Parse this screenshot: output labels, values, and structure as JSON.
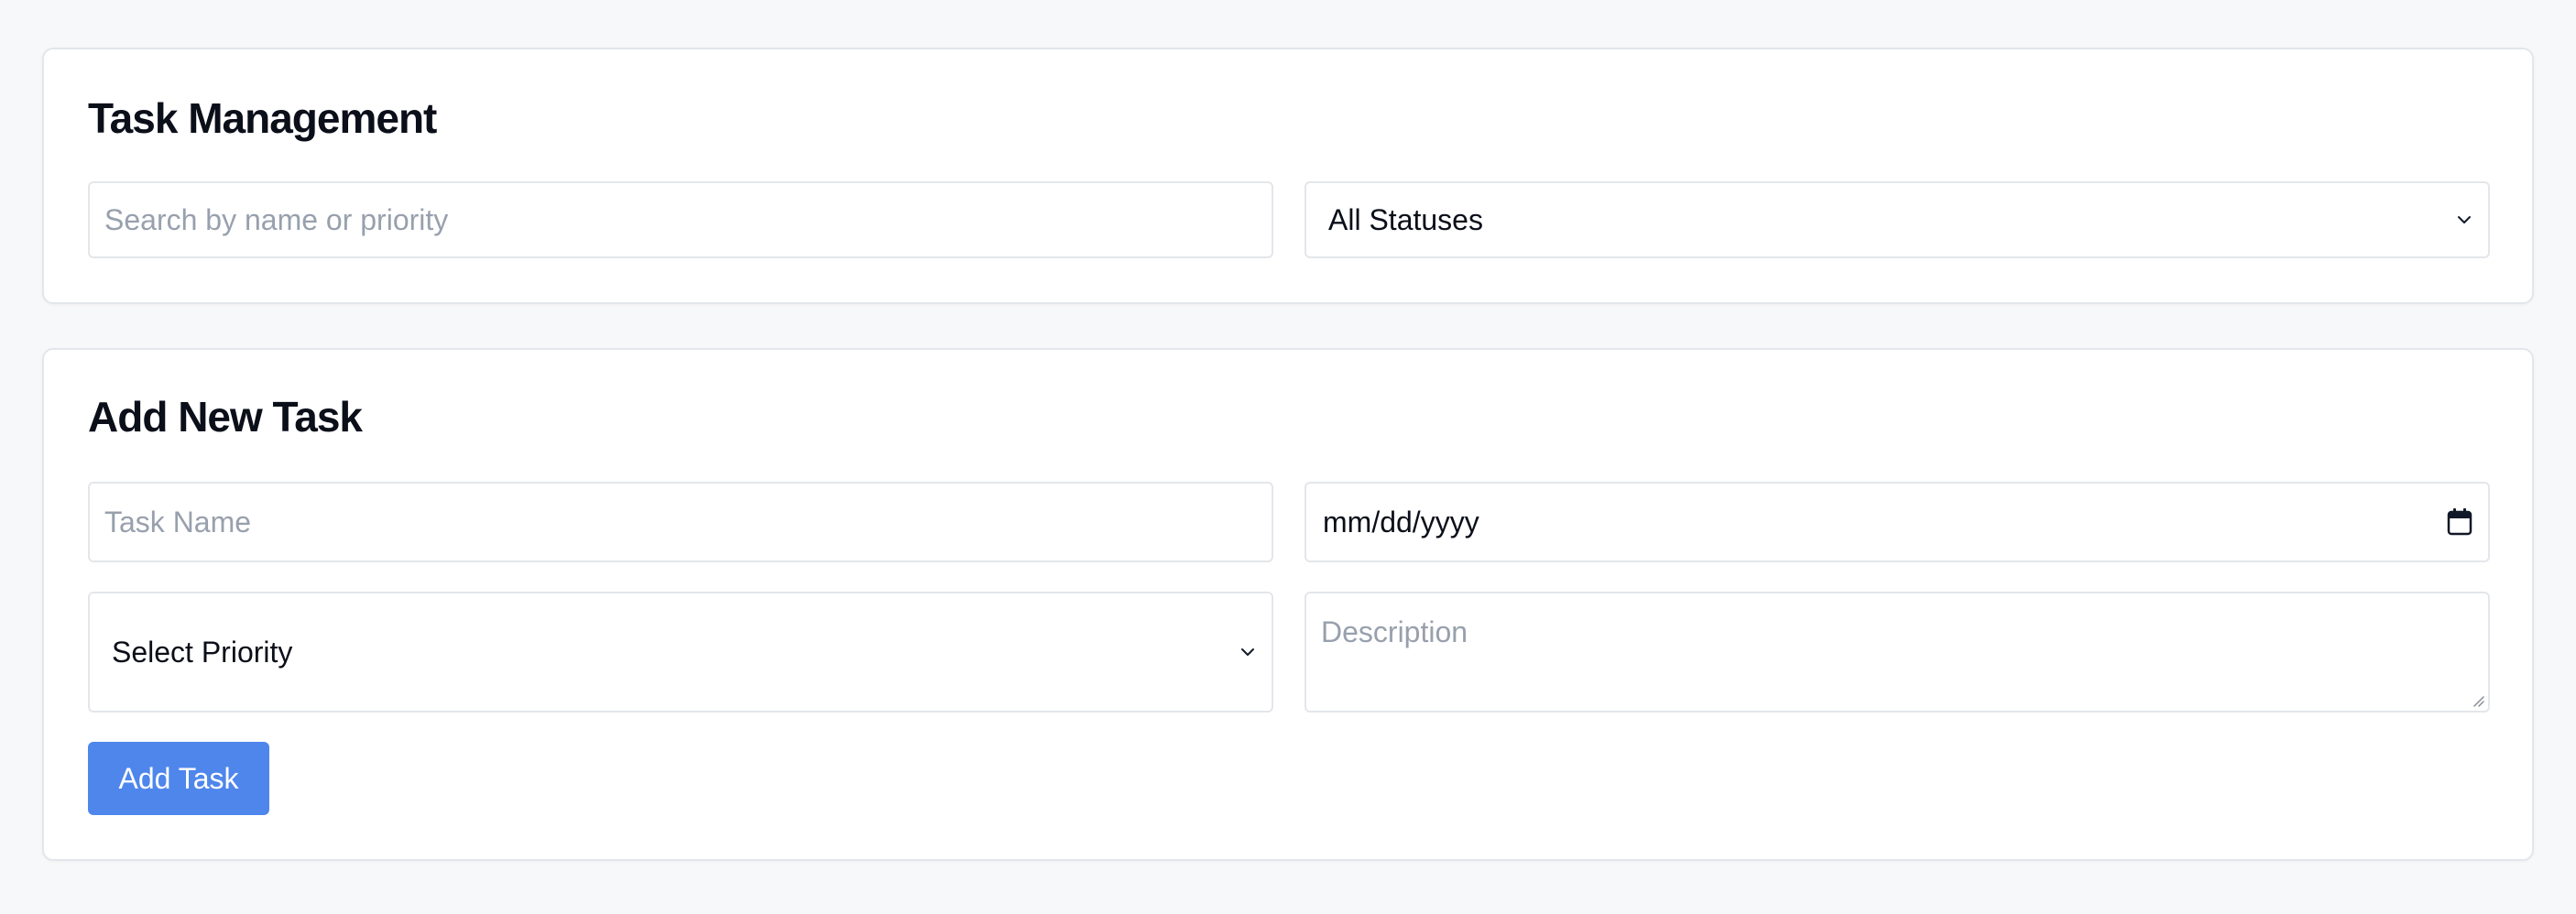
{
  "management": {
    "title": "Task Management",
    "search": {
      "placeholder": "Search by name or priority",
      "value": ""
    },
    "status_filter": {
      "selected": "All Statuses"
    }
  },
  "add_task": {
    "title": "Add New Task",
    "task_name": {
      "placeholder": "Task Name",
      "value": ""
    },
    "due_date": {
      "placeholder": "mm/dd/yyyy"
    },
    "priority": {
      "selected": "Select Priority"
    },
    "description": {
      "placeholder": "Description",
      "value": ""
    },
    "submit_label": "Add Task"
  },
  "icons": {
    "status_dropdown": "chevron-down-icon",
    "priority_dropdown": "chevron-down-icon",
    "date_picker": "calendar-icon",
    "textarea_resize": "resize-grip-icon"
  },
  "colors": {
    "accent": "#4f86ec",
    "background": "#f7f8f9",
    "border": "#e3e6ea",
    "placeholder": "#98a0ad"
  }
}
